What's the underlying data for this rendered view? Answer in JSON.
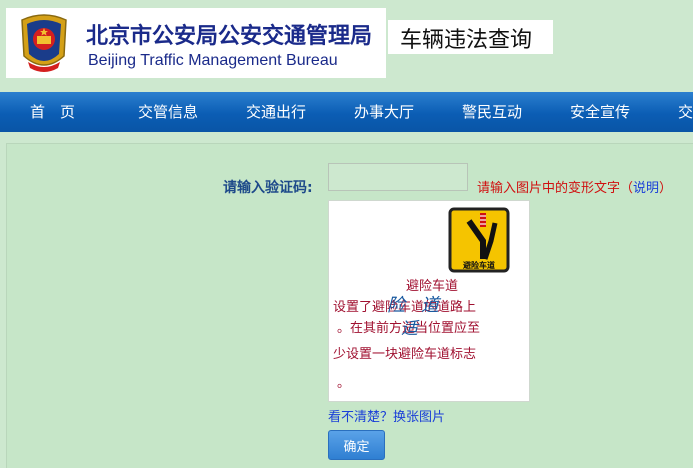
{
  "header": {
    "org_name_cn": "北京市公安局公安交通管理局",
    "org_name_en": "Beijing Traffic Management Bureau",
    "page_heading": "车辆违法查询"
  },
  "nav": {
    "items": [
      "首　页",
      "交管信息",
      "交通出行",
      "办事大厅",
      "警民互动",
      "安全宣传",
      "交"
    ]
  },
  "form": {
    "captcha_label": "请输入验证码:",
    "captcha_value": "",
    "captcha_hint": "请输入图片中的变形文字",
    "hint_paren_open": "（",
    "hint_link": "说明",
    "hint_paren_close": "）",
    "refresh_link": "看不清楚？换张图片",
    "confirm_button": "确定"
  },
  "captcha_image": {
    "sign_text": "避险车道",
    "lines": [
      "避险车道",
      "设置了避险车道的道路上",
      "。在其前方适当位置应至",
      "少设置一块避险车道标志",
      "。"
    ],
    "distort_chars": [
      "险",
      "道",
      "适"
    ]
  },
  "colors": {
    "nav_bg": "#0b5db4",
    "label_blue": "#1e4a8a",
    "hint_red": "#d01010",
    "link_blue": "#1a3fd8",
    "page_bg": "#cde8cf"
  }
}
